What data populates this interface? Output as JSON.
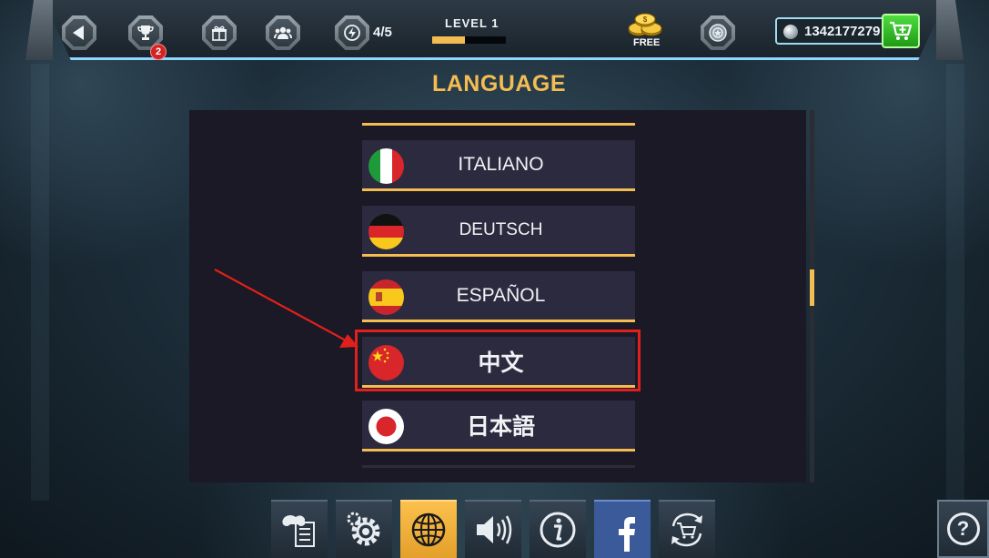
{
  "topbar": {
    "trophy_badge": "2",
    "energy": "4/5",
    "level_label": "LEVEL 1",
    "level_progress": 0.45,
    "free_label": "FREE",
    "currency": "1342177279",
    "icons": {
      "back": "back-arrow-icon",
      "trophy": "trophy-icon",
      "gift": "gift-icon",
      "friends": "friends-icon",
      "energy": "energy-icon",
      "coins": "coins-stack-icon",
      "profile": "profile-badge-icon",
      "currency": "silver-coin-icon",
      "cart": "cart-icon"
    }
  },
  "page": {
    "title": "LANGUAGE"
  },
  "languages": [
    {
      "label": "ITALIANO",
      "flag": "italy-flag-icon"
    },
    {
      "label": "DEUTSCH",
      "flag": "germany-flag-icon"
    },
    {
      "label": "ESPAÑOL",
      "flag": "spain-flag-icon"
    },
    {
      "label": "中文",
      "flag": "china-flag-icon",
      "highlighted": true
    },
    {
      "label": "日本語",
      "flag": "japan-flag-icon"
    }
  ],
  "bottom_menu": [
    {
      "name": "controls-settings-button",
      "icon": "gamepad-document-icon"
    },
    {
      "name": "graphics-settings-button",
      "icon": "gear-icon"
    },
    {
      "name": "language-button",
      "icon": "globe-icon",
      "active": true
    },
    {
      "name": "sound-button",
      "icon": "speaker-icon"
    },
    {
      "name": "info-button",
      "icon": "info-icon"
    },
    {
      "name": "facebook-button",
      "icon": "facebook-icon"
    },
    {
      "name": "restore-purchases-button",
      "icon": "cart-refresh-icon"
    }
  ],
  "colors": {
    "accent": "#f3bd52",
    "panel": "#1a1925",
    "item": "#2c2a3e",
    "highlight": "#e0201c",
    "topbar_glow": "#8fd6ff"
  }
}
